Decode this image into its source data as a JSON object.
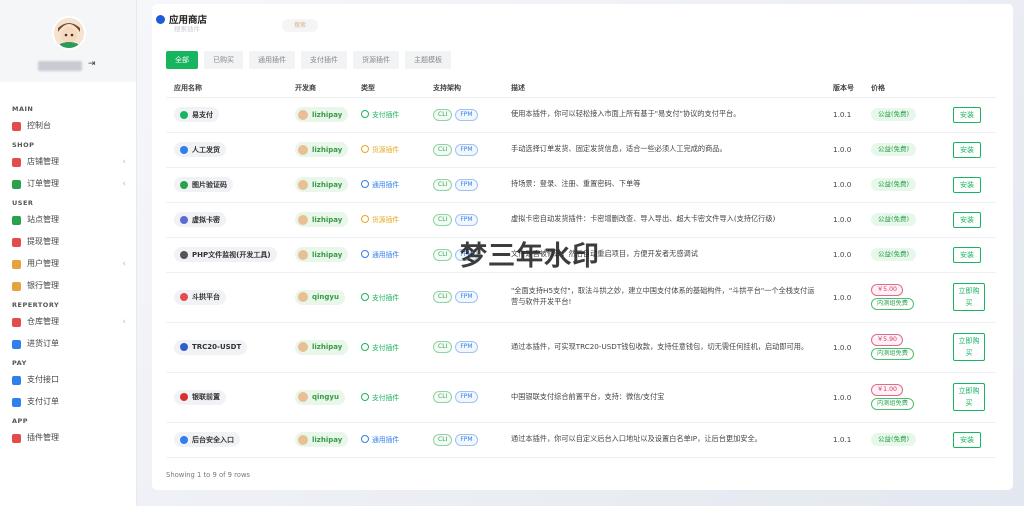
{
  "sidebar": {
    "logout_icon": "logout-icon",
    "sections": [
      {
        "title": "MAIN",
        "items": [
          {
            "label": "控制台",
            "color": "#e44c4c",
            "arrow": false
          }
        ]
      },
      {
        "title": "SHOP",
        "items": [
          {
            "label": "店铺管理",
            "color": "#e44c4c",
            "arrow": true
          },
          {
            "label": "订单管理",
            "color": "#2aa24c",
            "arrow": true
          }
        ]
      },
      {
        "title": "USER",
        "items": [
          {
            "label": "站点管理",
            "color": "#2aa24c",
            "arrow": false
          },
          {
            "label": "提现管理",
            "color": "#e44c4c",
            "arrow": false
          },
          {
            "label": "用户管理",
            "color": "#e6a23c",
            "arrow": true
          },
          {
            "label": "银行管理",
            "color": "#e6a23c",
            "arrow": false
          }
        ]
      },
      {
        "title": "REPERTORY",
        "items": [
          {
            "label": "仓库管理",
            "color": "#e44c4c",
            "arrow": true
          },
          {
            "label": "进货订单",
            "color": "#2f80ed",
            "arrow": false
          }
        ]
      },
      {
        "title": "PAY",
        "items": [
          {
            "label": "支付接口",
            "color": "#2f80ed",
            "arrow": false
          },
          {
            "label": "支付订单",
            "color": "#2f80ed",
            "arrow": false
          }
        ]
      },
      {
        "title": "APP",
        "items": [
          {
            "label": "插件管理",
            "color": "#e44c4c",
            "arrow": false
          }
        ]
      }
    ]
  },
  "header": {
    "title": "应用商店",
    "ghost_search": "搜索插件",
    "ghost_button": "搜索"
  },
  "tabs": [
    "全部",
    "已购买",
    "通用插件",
    "支付插件",
    "货源插件",
    "主题模板"
  ],
  "columns": [
    "应用名称",
    "开发商",
    "类型",
    "支持架构",
    "描述",
    "版本号",
    "价格",
    ""
  ],
  "arch": {
    "cli": "CLI",
    "fpm": "FPM"
  },
  "rows": [
    {
      "name": "易支付",
      "icon_color": "#17b55e",
      "dev": "lizhipay",
      "type": "支付插件",
      "tclass": "t-pay",
      "desc": "使用本插件，你可以轻松接入市面上所有基于\"易支付\"协议的支付平台。",
      "version": "1.0.1",
      "price": "公益(免费)",
      "action": "安装"
    },
    {
      "name": "人工发货",
      "icon_color": "#2f80ed",
      "dev": "lizhipay",
      "type": "货源插件",
      "tclass": "t-res",
      "desc": "手动选择订单发货、固定发货信息，适合一些必须人工完成的商品。",
      "version": "1.0.0",
      "price": "公益(免费)",
      "action": "安装"
    },
    {
      "name": "图片验证码",
      "icon_color": "#2aa24c",
      "dev": "lizhipay",
      "type": "通用插件",
      "tclass": "t-gen",
      "desc": "持场景：登录、注册、重置密码、下单等",
      "version": "1.0.0",
      "price": "公益(免费)",
      "action": "安装"
    },
    {
      "name": "虚拟卡密",
      "icon_color": "#5b6bd6",
      "dev": "lizhipay",
      "type": "货源插件",
      "tclass": "t-res",
      "desc": "虚拟卡密自动发货插件：卡密增删改查、导入导出、超大卡密文件导入(支持亿行级)",
      "version": "1.0.0",
      "price": "公益(免费)",
      "action": "安装"
    },
    {
      "name": "PHP文件监视(开发工具)",
      "icon_color": "#555555",
      "dev": "lizhipay",
      "type": "通用插件",
      "tclass": "t-gen",
      "desc": "文件是否被修改，然后自动重启项目，方便开发者无感调试",
      "version": "1.0.0",
      "price": "公益(免费)",
      "action": "安装"
    },
    {
      "name": "斗拱平台",
      "icon_color": "#e44c4c",
      "dev": "qingyu",
      "type": "支付插件",
      "tclass": "t-pay",
      "desc": "\"全面支持H5支付\"，取法斗拱之妙，建立中国支付体系的基础构件，\"斗拱平台\"一个全栈支付运营与软件开发平台!",
      "version": "1.0.0",
      "price": "￥5.00",
      "price_sub": "内测组免费",
      "action": "立即购买",
      "tall": true
    },
    {
      "name": "TRC20-USDT",
      "icon_color": "#2f5fd0",
      "dev": "lizhipay",
      "type": "支付插件",
      "tclass": "t-pay",
      "desc": "通过本插件，可实现TRC20-USDT钱包收款，支持任意钱包，切无需任何挂机，启动即可用。",
      "version": "1.0.0",
      "price": "￥5.90",
      "price_sub": "内测组免费",
      "action": "立即购买",
      "tall": true
    },
    {
      "name": "银联前置",
      "icon_color": "#d8302f",
      "dev": "qingyu",
      "type": "支付插件",
      "tclass": "t-pay",
      "desc": "中国银联支付综合前置平台，支持：微信/支付宝",
      "version": "1.0.0",
      "price": "￥1.00",
      "price_sub": "内测组免费",
      "action": "立即购买",
      "tall": true
    },
    {
      "name": "后台安全入口",
      "icon_color": "#2f80ed",
      "dev": "lizhipay",
      "type": "通用插件",
      "tclass": "t-gen",
      "desc": "通过本插件，你可以自定义后台入口地址以及设置白名单IP，让后台更加安全。",
      "version": "1.0.1",
      "price": "公益(免费)",
      "action": "安装"
    }
  ],
  "footer": "Showing 1 to 9 of 9 rows",
  "watermark": "梦三年水印"
}
